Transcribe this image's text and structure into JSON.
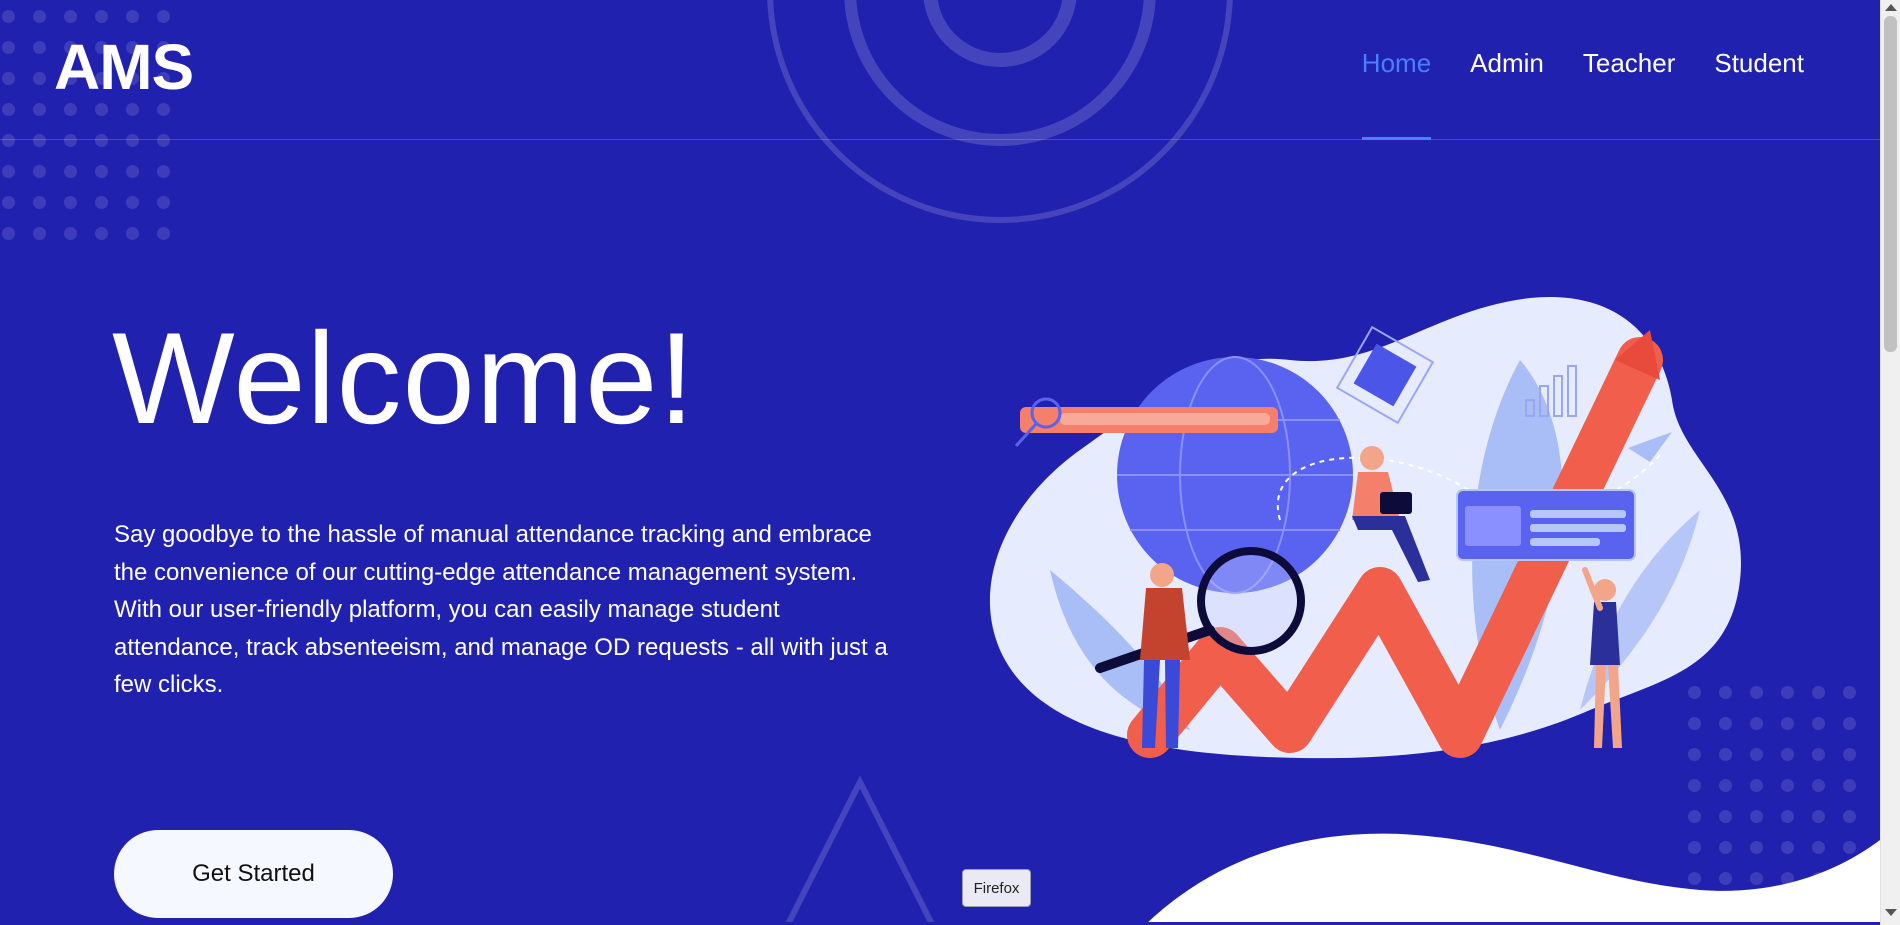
{
  "brand": {
    "logo": "AMS"
  },
  "nav": {
    "items": [
      {
        "label": "Home",
        "active": true
      },
      {
        "label": "Admin",
        "active": false
      },
      {
        "label": "Teacher",
        "active": false
      },
      {
        "label": "Student",
        "active": false
      }
    ]
  },
  "hero": {
    "title": "Welcome!",
    "description": "Say goodbye to the hassle of manual attendance tracking and embrace the convenience of our cutting-edge attendance management system. With our user-friendly platform, you can easily manage student attendance, track absenteeism, and manage OD requests - all with just a few clicks.",
    "cta_label": "Get Started"
  },
  "tooltip": {
    "text": "Firefox"
  },
  "colors": {
    "background": "#2121b0",
    "nav_active": "#4b7dff",
    "cta_background": "#f6f8ff",
    "illustration_accent": "#f0564a"
  }
}
